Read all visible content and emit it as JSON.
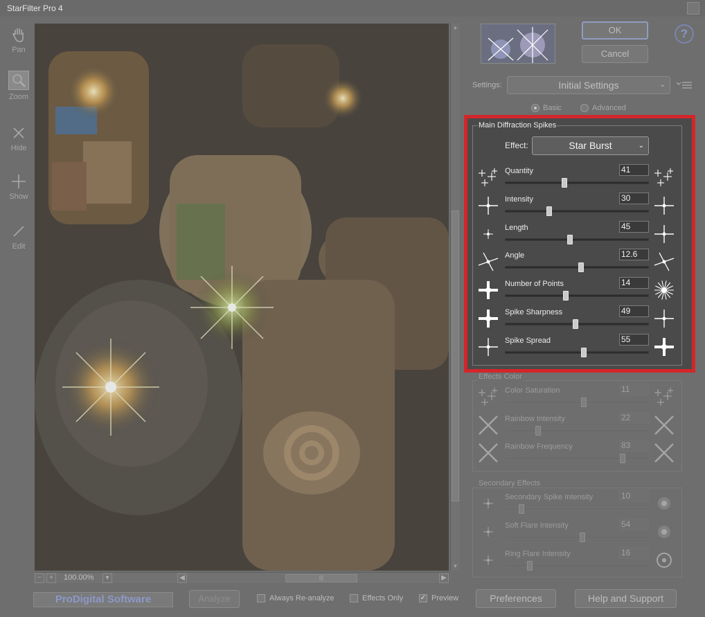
{
  "window": {
    "title": "StarFilter Pro 4"
  },
  "toolbar": {
    "pan": "Pan",
    "zoom": "Zoom",
    "hide": "Hide",
    "show": "Show",
    "edit": "Edit"
  },
  "statusbar": {
    "zoom_level": "100.00%"
  },
  "buttons": {
    "ok": "OK",
    "cancel": "Cancel",
    "analyze": "Analyze",
    "preferences": "Preferences",
    "help_support": "Help and Support",
    "help_icon": "?"
  },
  "brand": {
    "text": "ProDigital Software"
  },
  "options": {
    "always_reanalyze": "Always Re-analyze",
    "always_reanalyze_checked": false,
    "effects_only": "Effects Only",
    "effects_only_checked": false,
    "preview": "Preview",
    "preview_checked": true
  },
  "settings": {
    "label": "Settings:",
    "selected": "Initial Settings",
    "mode_basic": "Basic",
    "mode_advanced": "Advanced",
    "mode_selected": "Basic"
  },
  "main": {
    "title": "Main Diffraction Spikes",
    "effect_label": "Effect:",
    "effect_value": "Star Burst",
    "sliders": [
      {
        "label": "Quantity",
        "value": "41",
        "fraction": 0.41
      },
      {
        "label": "Intensity",
        "value": "30",
        "fraction": 0.3
      },
      {
        "label": "Length",
        "value": "45",
        "fraction": 0.45
      },
      {
        "label": "Angle",
        "value": "12.6",
        "fraction": 0.53
      },
      {
        "label": "Number of Points",
        "value": "14",
        "fraction": 0.42
      },
      {
        "label": "Spike Sharpness",
        "value": "49",
        "fraction": 0.49
      },
      {
        "label": "Spike Spread",
        "value": "55",
        "fraction": 0.55
      }
    ]
  },
  "color": {
    "title": "Effects Color",
    "sliders": [
      {
        "label": "Color Saturation",
        "value": "11",
        "fraction": 0.55
      },
      {
        "label": "Rainbow Intensity",
        "value": "22",
        "fraction": 0.22
      },
      {
        "label": "Rainbow Frequency",
        "value": "83",
        "fraction": 0.83
      }
    ]
  },
  "secondary": {
    "title": "Secondary Effects",
    "sliders": [
      {
        "label": "Secondary Spike Intensity",
        "value": "10",
        "fraction": 0.1
      },
      {
        "label": "Soft Flare Intensity",
        "value": "54",
        "fraction": 0.54
      },
      {
        "label": "Ring Flare Intensity",
        "value": "16",
        "fraction": 0.16
      }
    ]
  },
  "colors": {
    "highlight": "#d3262a",
    "accent_help": "#8c95c9"
  }
}
